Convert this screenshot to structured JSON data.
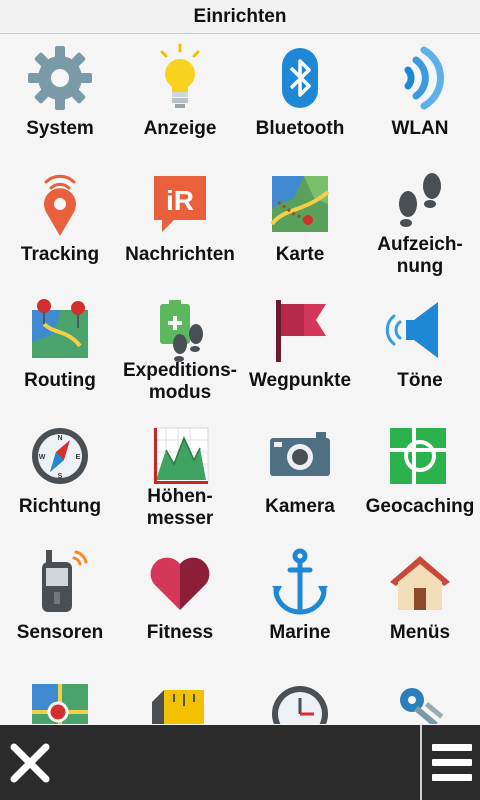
{
  "header": {
    "title": "Einrichten"
  },
  "items": [
    {
      "label": "System",
      "icon": "gear-icon"
    },
    {
      "label": "Anzeige",
      "icon": "lightbulb-icon"
    },
    {
      "label": "Bluetooth",
      "icon": "bluetooth-icon"
    },
    {
      "label": "WLAN",
      "icon": "wifi-icon"
    },
    {
      "label": "Tracking",
      "icon": "location-pin-icon"
    },
    {
      "label": "Nachrichten",
      "icon": "message-ir-icon"
    },
    {
      "label": "Karte",
      "icon": "map-icon"
    },
    {
      "label": "Aufzeich-\nnung",
      "icon": "footprints-icon"
    },
    {
      "label": "Routing",
      "icon": "route-map-icon"
    },
    {
      "label": "Expeditions-\nmodus",
      "icon": "battery-footprints-icon"
    },
    {
      "label": "Wegpunkte",
      "icon": "flag-icon"
    },
    {
      "label": "Töne",
      "icon": "speaker-icon"
    },
    {
      "label": "Richtung",
      "icon": "compass-icon"
    },
    {
      "label": "Höhen-\nmesser",
      "icon": "elevation-chart-icon"
    },
    {
      "label": "Kamera",
      "icon": "camera-icon"
    },
    {
      "label": "Geocaching",
      "icon": "geocache-icon"
    },
    {
      "label": "Sensoren",
      "icon": "gps-device-icon"
    },
    {
      "label": "Fitness",
      "icon": "heart-icon"
    },
    {
      "label": "Marine",
      "icon": "anchor-icon"
    },
    {
      "label": "Menüs",
      "icon": "house-icon"
    },
    {
      "label": "",
      "icon": "map-pin-icon"
    },
    {
      "label": "",
      "icon": "ruler-icon"
    },
    {
      "label": "",
      "icon": "clock-icon"
    },
    {
      "label": "",
      "icon": "keys-icon"
    }
  ],
  "footer": {
    "close_icon": "close-icon",
    "menu_icon": "hamburger-menu-icon"
  }
}
